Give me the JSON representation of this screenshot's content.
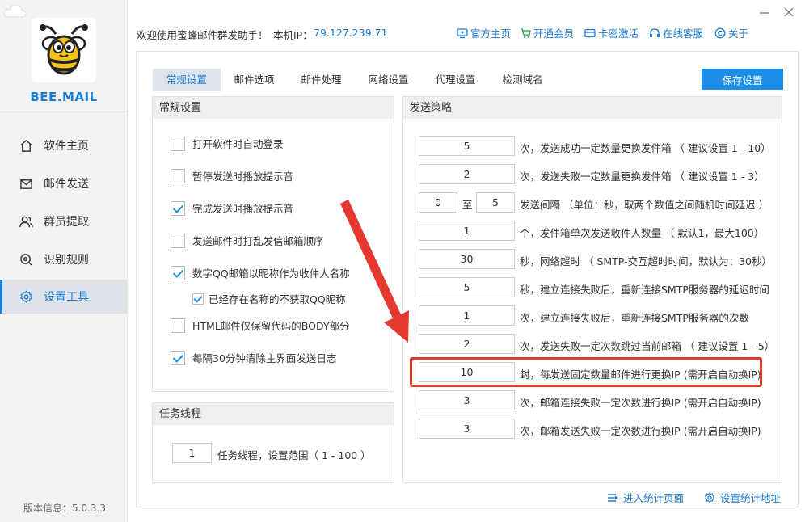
{
  "sidebar": {
    "brand": "BEE.MAIL",
    "items": [
      {
        "label": "软件主页",
        "icon": "home-icon"
      },
      {
        "label": "邮件发送",
        "icon": "mail-icon"
      },
      {
        "label": "群员提取",
        "icon": "users-icon"
      },
      {
        "label": "识别规则",
        "icon": "search-icon"
      },
      {
        "label": "设置工具",
        "icon": "gear-icon",
        "active": true
      }
    ],
    "version": "版本信息：5.0.3.3"
  },
  "topbar": {
    "welcome": "欢迎使用蜜蜂邮件群发助手！",
    "ip_label": "本机IP：",
    "ip_value": "79.127.239.71",
    "links": [
      {
        "label": "官方主页",
        "icon": "monitor-icon"
      },
      {
        "label": "开通会员",
        "icon": "cart-icon"
      },
      {
        "label": "卡密激活",
        "icon": "card-icon"
      },
      {
        "label": "在线客服",
        "icon": "headset-icon"
      },
      {
        "label": "关于",
        "icon": "copyright-icon"
      }
    ]
  },
  "tabs": [
    "常规设置",
    "邮件选项",
    "邮件处理",
    "网络设置",
    "代理设置",
    "检测域名"
  ],
  "active_tab": "常规设置",
  "save_button": "保存设置",
  "general": {
    "title": "常规设置",
    "options": [
      {
        "label": "打开软件时自动登录",
        "checked": false
      },
      {
        "label": "暂停发送时播放提示音",
        "checked": false
      },
      {
        "label": "完成发送时播放提示音",
        "checked": true
      },
      {
        "label": "发送邮件时打乱发信邮箱顺序",
        "checked": false
      },
      {
        "label": "数字QQ邮箱以昵称作为收件人名称",
        "checked": true
      },
      {
        "label": "已经存在名称的不获取QQ昵称",
        "checked": true,
        "sub": true
      },
      {
        "label": "HTML邮件仅保留代码的BODY部分",
        "checked": false
      },
      {
        "label": "每隔30分钟清除主界面发送日志",
        "checked": true
      }
    ]
  },
  "threads": {
    "title": "任务线程",
    "value": "1",
    "text": "任务线程，设置范围（ 1 - 100 ）"
  },
  "strategy": {
    "title": "发送策略",
    "rows": [
      {
        "value": "5",
        "text": "次，发送成功一定数量更换发件箱 （ 建议设置 1 - 10）"
      },
      {
        "value": "2",
        "text": "次，发送失败一定数量更换发件箱 （ 建议设置 1 - 3）"
      },
      {
        "value": "0",
        "value2": "5",
        "mid": "至",
        "text": "发送间隔 （单位：秒，取两个数值之间随机时间延迟 ）"
      },
      {
        "value": "1",
        "text": "个，发件箱单次发送收件人数量 （ 默认1，最大100）"
      },
      {
        "value": "30",
        "text": "秒，网络超时 （ SMTP-交互超时时间，默认为：30秒）"
      },
      {
        "value": "5",
        "text": "秒，建立连接失败后，重新连接SMTP服务器的延迟时间"
      },
      {
        "value": "1",
        "text": "次，建立连接失败后，重新连接SMTP服务器的次数"
      },
      {
        "value": "2",
        "text": "次，发送失败一定次数跳过当前邮箱 （ 建议设置 1 - 5）"
      },
      {
        "value": "10",
        "text": "封，每发送固定数量邮件进行更换IP (需开启自动换IP)",
        "highlighted": true
      },
      {
        "value": "3",
        "text": "次，邮箱连接失败一定次数进行换IP (需开启自动换IP)"
      },
      {
        "value": "3",
        "text": "次，邮箱发送失败一定次数进行换IP (需开启自动换IP)"
      }
    ]
  },
  "bottom_links": [
    {
      "label": "进入统计页面",
      "icon": "list-icon"
    },
    {
      "label": "设置统计地址",
      "icon": "gear-icon"
    }
  ],
  "colors": {
    "accent": "#1b8ee8",
    "highlight": "#e5392f"
  }
}
